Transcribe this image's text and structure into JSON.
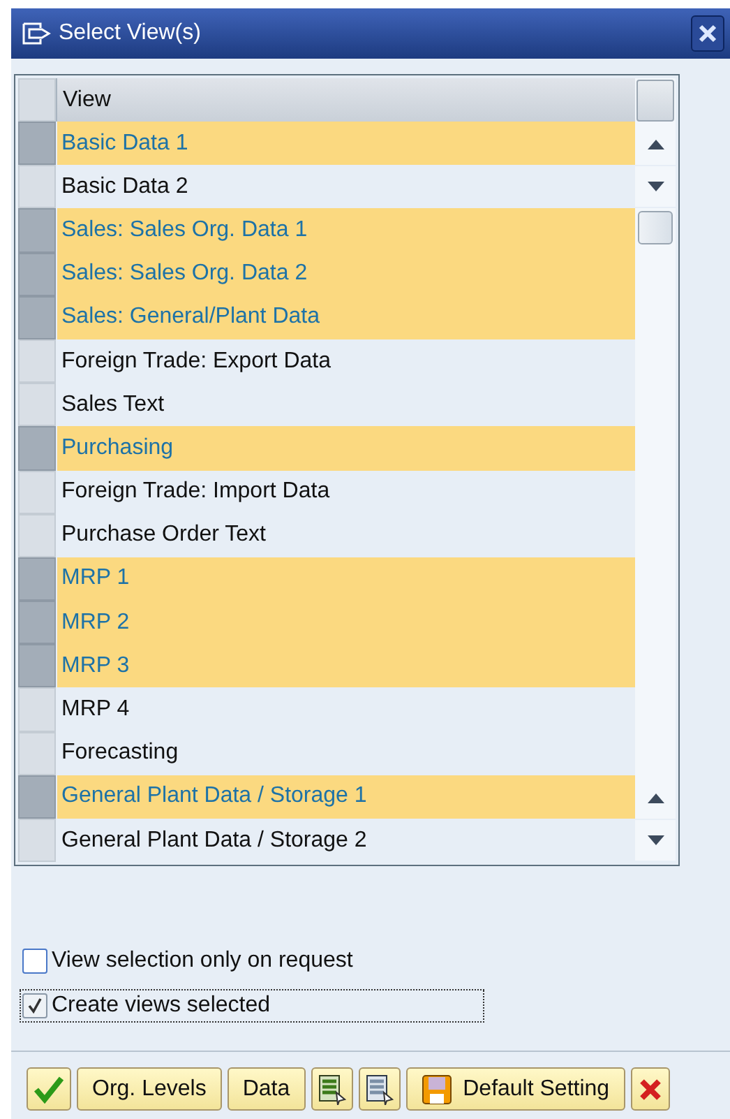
{
  "window": {
    "title": "Select View(s)"
  },
  "table": {
    "columns": [
      "View"
    ],
    "rows": [
      {
        "label": "Basic Data 1",
        "selected": true
      },
      {
        "label": "Basic Data 2",
        "selected": false
      },
      {
        "label": "Sales: Sales Org. Data 1",
        "selected": true
      },
      {
        "label": "Sales: Sales Org. Data 2",
        "selected": true
      },
      {
        "label": "Sales: General/Plant Data",
        "selected": true
      },
      {
        "label": "Foreign Trade: Export Data",
        "selected": false
      },
      {
        "label": "Sales Text",
        "selected": false
      },
      {
        "label": "Purchasing",
        "selected": true
      },
      {
        "label": "Foreign Trade: Import Data",
        "selected": false
      },
      {
        "label": "Purchase Order Text",
        "selected": false
      },
      {
        "label": "MRP 1",
        "selected": true
      },
      {
        "label": "MRP 2",
        "selected": true
      },
      {
        "label": "MRP 3",
        "selected": true
      },
      {
        "label": "MRP 4",
        "selected": false
      },
      {
        "label": "Forecasting",
        "selected": false
      },
      {
        "label": "General Plant Data / Storage 1",
        "selected": true
      },
      {
        "label": "General Plant Data / Storage 2",
        "selected": false
      }
    ]
  },
  "options": [
    {
      "label": "View selection only on request",
      "checked": false
    },
    {
      "label": "Create views selected",
      "checked": true
    }
  ],
  "buttons": [
    {
      "kind": "confirm"
    },
    {
      "kind": "text",
      "label": "Org. Levels"
    },
    {
      "kind": "text",
      "label": "Data"
    },
    {
      "kind": "list-green"
    },
    {
      "kind": "list-grey"
    },
    {
      "kind": "save",
      "label": "Default Setting"
    },
    {
      "kind": "cancel"
    }
  ]
}
